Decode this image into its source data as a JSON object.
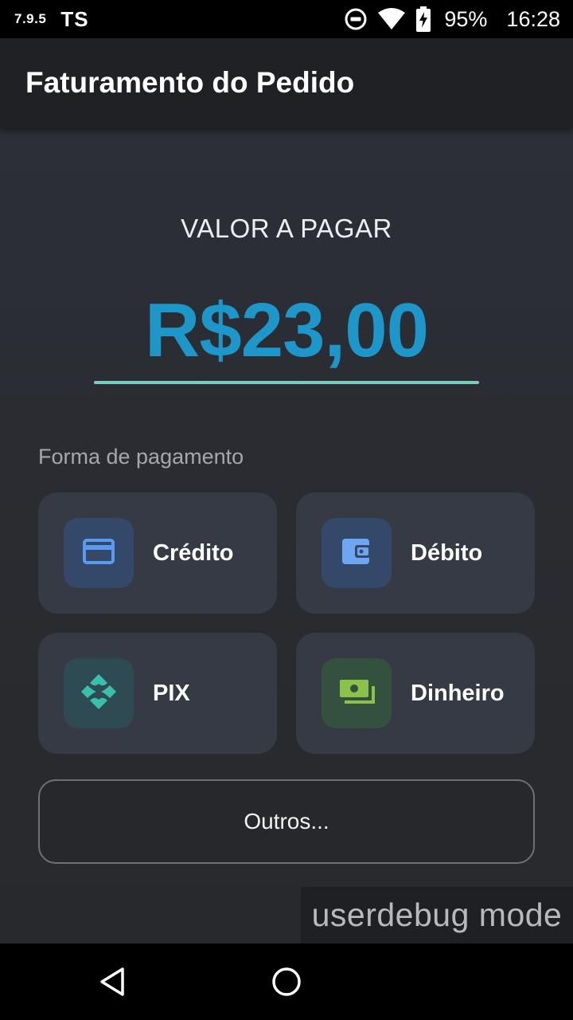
{
  "status_bar": {
    "version": "7.9.5",
    "carrier_tag": "TS",
    "battery_percent": "95%",
    "time": "16:28",
    "icons": [
      "do-not-disturb-icon",
      "wifi-icon",
      "battery-charging-icon"
    ]
  },
  "app_bar": {
    "title": "Faturamento do Pedido"
  },
  "amount": {
    "label": "VALOR A PAGAR",
    "value": "R$23,00"
  },
  "payment": {
    "section_label": "Forma de pagamento",
    "methods": [
      {
        "label": "Crédito",
        "icon": "credit-card-icon",
        "accent": "#5b9bef"
      },
      {
        "label": "Débito",
        "icon": "wallet-icon",
        "accent": "#6fa6f2"
      },
      {
        "label": "PIX",
        "icon": "pix-icon",
        "accent": "#3bbfad"
      },
      {
        "label": "Dinheiro",
        "icon": "cash-icon",
        "accent": "#8bc34a"
      }
    ],
    "other_label": "Outros..."
  },
  "debug_overlay": "userdebug mode",
  "colors": {
    "amount": "#1d97c9",
    "underline": "#7ecbc2",
    "card_bg": "#363a44",
    "background": "#2a2c30"
  }
}
